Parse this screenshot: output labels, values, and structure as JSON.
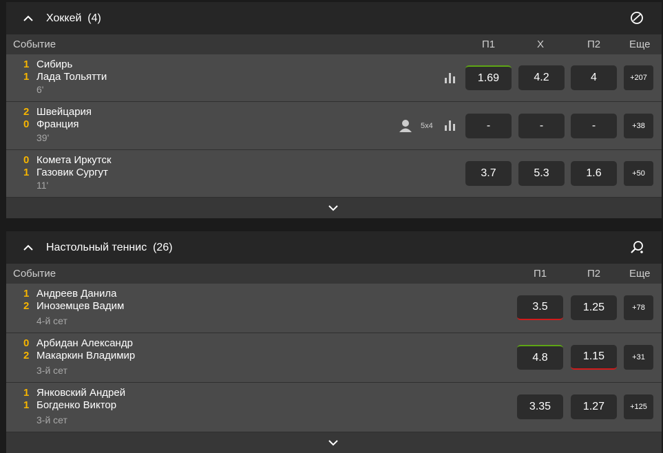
{
  "hockey": {
    "title": "Хоккей",
    "count": "(4)",
    "icon": "hockey-puck-icon",
    "columns": {
      "event": "Событие",
      "p1": "П1",
      "x": "Х",
      "p2": "П2",
      "more": "Еще"
    },
    "matches": [
      {
        "score1": "1",
        "score2": "1",
        "team1": "Сибирь",
        "team2": "Лада Тольятти",
        "time": "6'",
        "p1": "1.69",
        "x": "4.2",
        "p2": "4",
        "more": "+207"
      },
      {
        "score1": "2",
        "score2": "0",
        "team1": "Швейцария",
        "team2": "Франция",
        "time": "39'",
        "format": "5х4",
        "p1": "-",
        "x": "-",
        "p2": "-",
        "more": "+38"
      },
      {
        "score1": "0",
        "score2": "1",
        "team1": "Комета Иркутск",
        "team2": "Газовик Сургут",
        "time": "11'",
        "p1": "3.7",
        "x": "5.3",
        "p2": "1.6",
        "more": "+50"
      }
    ]
  },
  "tennis": {
    "title": "Настольный теннис",
    "count": "(26)",
    "icon": "table-tennis-paddle-icon",
    "columns": {
      "event": "Событие",
      "p1": "П1",
      "p2": "П2",
      "more": "Еще"
    },
    "matches": [
      {
        "score1": "1",
        "score2": "2",
        "team1": "Андреев Данила",
        "team2": "Иноземцев Вадим",
        "time": "4-й сет",
        "p1": "3.5",
        "p2": "1.25",
        "more": "+78"
      },
      {
        "score1": "0",
        "score2": "2",
        "team1": "Арбидан Александр",
        "team2": "Макаркин Владимир",
        "time": "3-й сет",
        "p1": "4.8",
        "p2": "1.15",
        "more": "+31"
      },
      {
        "score1": "1",
        "score2": "1",
        "team1": "Янковский Андрей",
        "team2": "Богденко Виктор",
        "time": "3-й сет",
        "p1": "3.35",
        "p2": "1.27",
        "more": "+125"
      }
    ]
  },
  "colors": {
    "score": "#f7b500",
    "odd_up": "#5ea614",
    "odd_down": "#d11b1b",
    "header": "#262626",
    "row": "#4a4a4a"
  }
}
